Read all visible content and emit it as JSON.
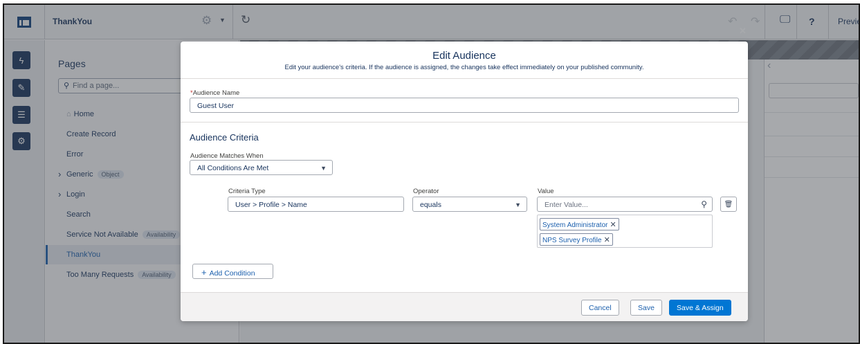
{
  "topbar": {
    "page_title": "ThankYou",
    "preview_label": "Previe"
  },
  "pages_panel": {
    "title": "Pages",
    "search_placeholder": "Find a page...",
    "items": [
      {
        "label": "Home"
      },
      {
        "label": "Create Record"
      },
      {
        "label": "Error"
      },
      {
        "label": "Generic",
        "badge": "Object"
      },
      {
        "label": "Login"
      },
      {
        "label": "Search"
      },
      {
        "label": "Service Not Available",
        "badge": "Availability"
      },
      {
        "label": "ThankYou"
      },
      {
        "label": "Too Many Requests",
        "badge": "Availability"
      }
    ]
  },
  "modal": {
    "title": "Edit Audience",
    "subtitle": "Edit your audience's criteria. If the audience is assigned, the changes take effect immediately on your published community.",
    "audience_name_label": "Audience Name",
    "audience_name_value": "Guest User",
    "criteria_section_title": "Audience Criteria",
    "matches_label": "Audience Matches When",
    "matches_value": "All Conditions Are Met",
    "criteria_type_label": "Criteria Type",
    "criteria_type_value": "User > Profile > Name",
    "operator_label": "Operator",
    "operator_value": "equals",
    "value_label": "Value",
    "value_placeholder": "Enter Value...",
    "selected_values": [
      "System Administrator",
      "NPS Survey Profile"
    ],
    "add_condition_label": "Add Condition",
    "cancel_label": "Cancel",
    "save_label": "Save",
    "save_assign_label": "Save & Assign"
  }
}
